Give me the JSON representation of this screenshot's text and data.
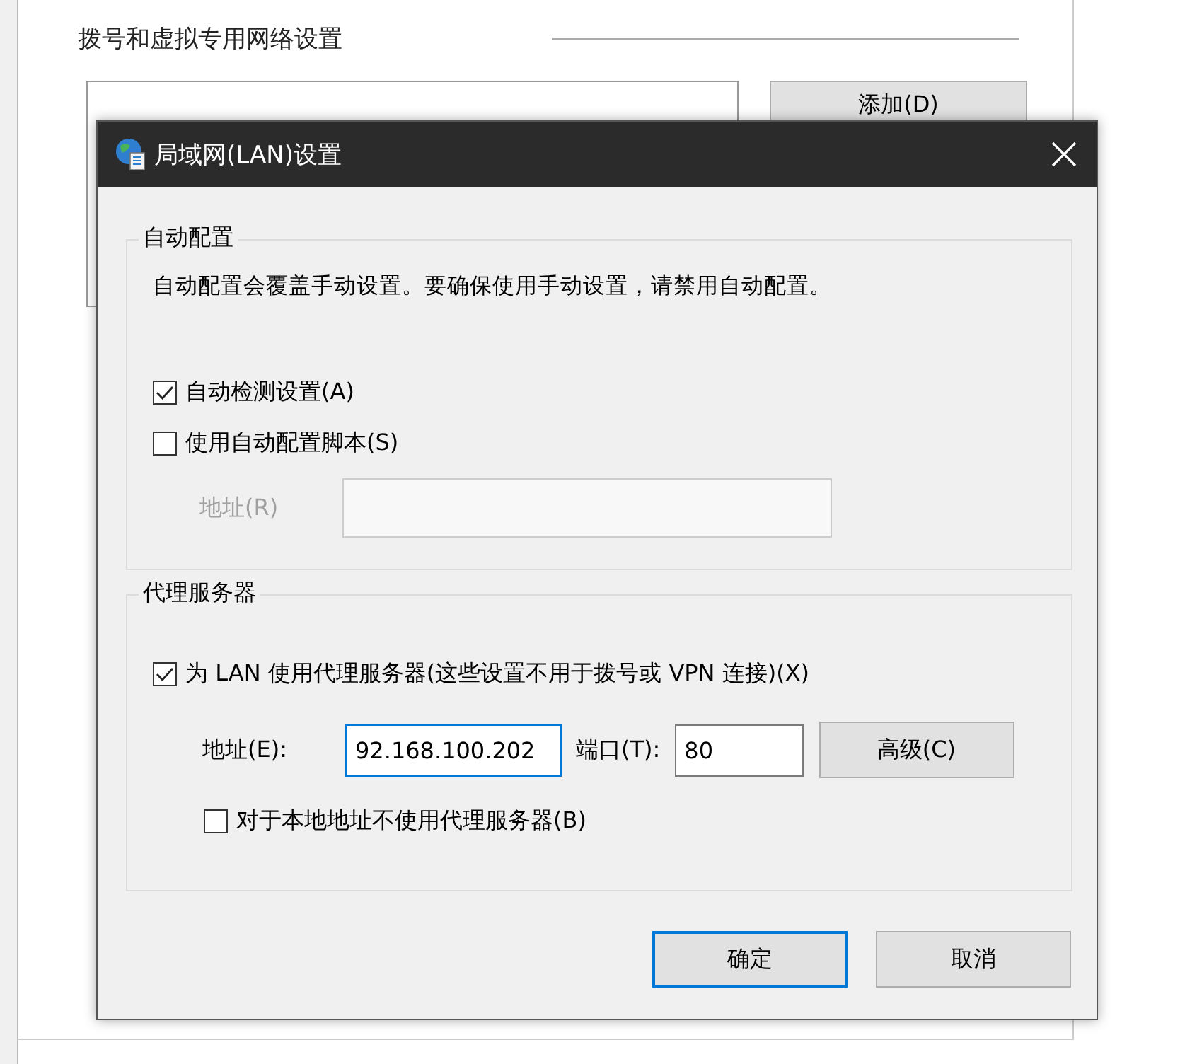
{
  "background_window": {
    "heading": "拨号和虚拟专用网络设置",
    "add_button": "添加(D)"
  },
  "dialog": {
    "title": "局域网(LAN)设置",
    "auto_config": {
      "title": "自动配置",
      "description": "自动配置会覆盖手动设置。要确保使用手动设置，请禁用自动配置。",
      "options": [
        {
          "label": "自动检测设置(A)",
          "checked": true
        },
        {
          "label": "使用自动配置脚本(S)",
          "checked": false
        }
      ],
      "address": {
        "label": "地址(R)",
        "disabled": true
      }
    },
    "proxy": {
      "title": "代理服务器",
      "use_proxy": {
        "label": "为 LAN 使用代理服务器(这些设置不用于拨号或 VPN 连接)(X)",
        "checked": true
      },
      "address": {
        "label": "地址(E):",
        "value": "92.168.100.202",
        "focused": true
      },
      "port": {
        "label": "端口(T):",
        "value": "80"
      },
      "advanced_button": "高级(C)",
      "bypass_local": {
        "label": "对于本地地址不使用代理服务器(B)",
        "checked": false
      }
    },
    "buttons": [
      {
        "label": "确定",
        "default": true
      },
      {
        "label": "取消",
        "default": false
      }
    ]
  }
}
